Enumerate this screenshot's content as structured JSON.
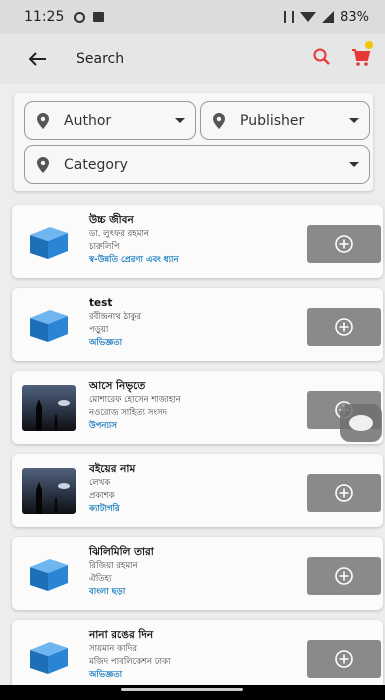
{
  "status": {
    "time": "11:25",
    "battery": "83%"
  },
  "app_bar": {
    "title": "Search",
    "back_icon": "back-arrow-icon",
    "search_icon": "search-icon",
    "cart_icon": "cart-icon",
    "accent": "#e53935"
  },
  "filters": {
    "author": "Author",
    "publisher": "Publisher",
    "category": "Category"
  },
  "books": [
    {
      "title": "উচ্চ জীবন",
      "author": "ডা. লুৎফর রহমান",
      "publisher": "চারুলিপি",
      "category": "স্ব-উন্নতি প্রেরণা এবং ধ্যান",
      "thumb": "book"
    },
    {
      "title": "test",
      "author": "রবীন্দ্রনাথ ঠাকুর",
      "publisher": "পড়ুয়া",
      "category": "অভিজ্ঞতা",
      "thumb": "book"
    },
    {
      "title": "আসে নিভৃতে",
      "author": "মোশারেফ হোসেন শাজাহান",
      "publisher": "নওরোজ সাহিত্য সংসদ",
      "category": "উপন্যাস",
      "thumb": "dark"
    },
    {
      "title": "বইয়ের নাম",
      "author": "লেখক",
      "publisher": "প্রকাশক",
      "category": "ক্যাটাগরি",
      "thumb": "dark"
    },
    {
      "title": "ঝিলিমিলি তারা",
      "author": "রিজিয়া রহমান",
      "publisher": "ঐতিহ্য",
      "category": "বাংলা ছড়া",
      "thumb": "book"
    },
    {
      "title": "নানা রঙের দিন",
      "author": "সায়মান কাদির",
      "publisher": "মজিদ পাবলিকেশন ঢাকা",
      "category": "অভিজ্ঞতা",
      "thumb": "book"
    }
  ]
}
